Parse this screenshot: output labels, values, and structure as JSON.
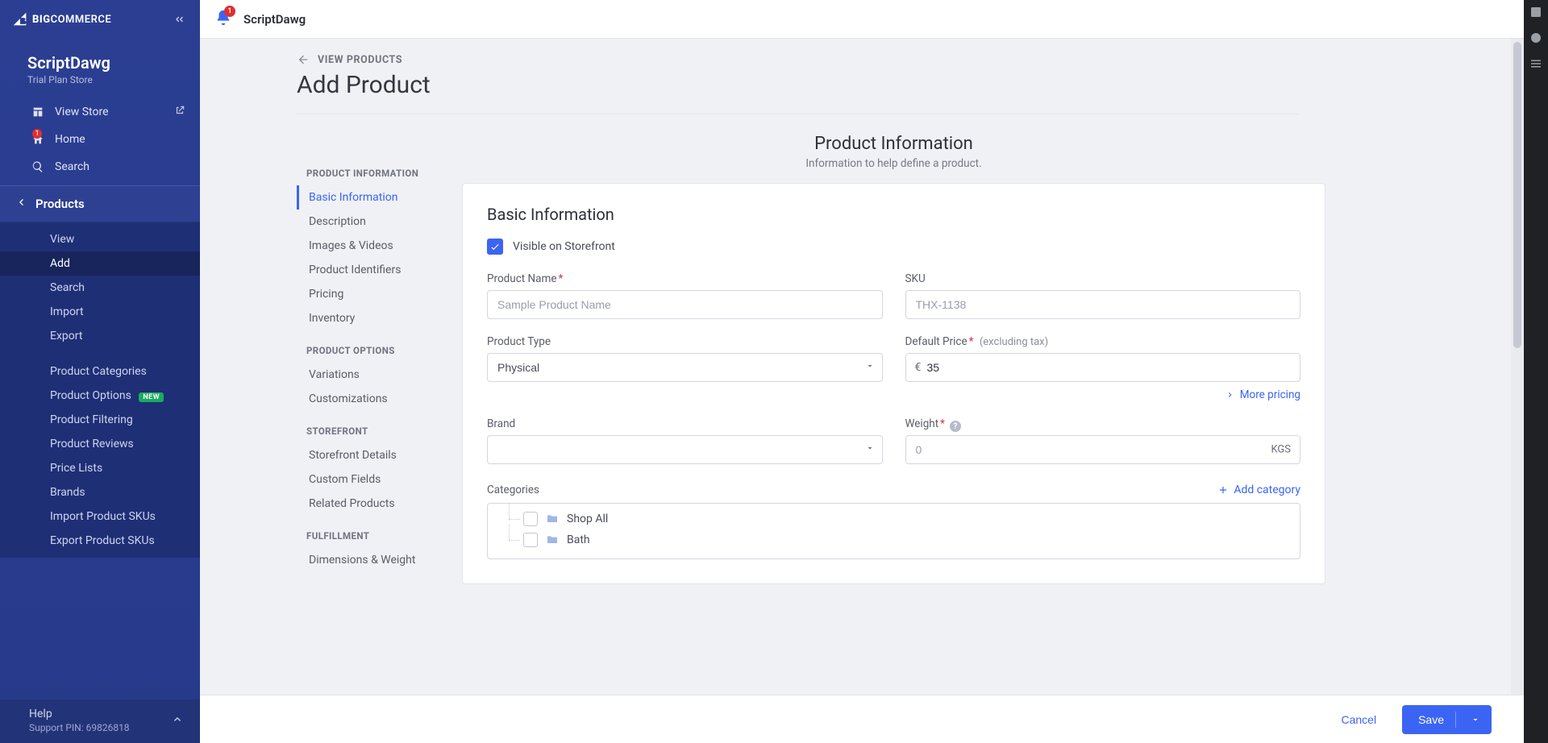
{
  "brand_text_big": "BIG",
  "brand_text_rest": "COMMERCE",
  "store": {
    "name": "ScriptDawg",
    "plan": "Trial Plan Store"
  },
  "topnav": {
    "view_store": "View Store",
    "home": "Home",
    "home_badge": "1",
    "search": "Search"
  },
  "section": {
    "products": "Products"
  },
  "subnav": {
    "view": "View",
    "add": "Add",
    "search": "Search",
    "import": "Import",
    "export": "Export",
    "categories": "Product Categories",
    "options": "Product Options",
    "options_badge": "NEW",
    "filtering": "Product Filtering",
    "reviews": "Product Reviews",
    "pricelists": "Price Lists",
    "brands": "Brands",
    "import_skus": "Import Product SKUs",
    "export_skus": "Export Product SKUs"
  },
  "help": {
    "label": "Help",
    "pin": "Support PIN: 69826818"
  },
  "topbar": {
    "bell_count": "1",
    "crumb": "ScriptDawg"
  },
  "page": {
    "back": "VIEW PRODUCTS",
    "title": "Add Product"
  },
  "anchors": {
    "g1": "PRODUCT INFORMATION",
    "basic": "Basic Information",
    "desc": "Description",
    "images": "Images & Videos",
    "ids": "Product Identifiers",
    "pricing": "Pricing",
    "inventory": "Inventory",
    "g2": "PRODUCT OPTIONS",
    "variations": "Variations",
    "custom": "Customizations",
    "g3": "STOREFRONT",
    "sfdetails": "Storefront Details",
    "cfields": "Custom Fields",
    "related": "Related Products",
    "g4": "FULFILLMENT",
    "dims": "Dimensions & Weight"
  },
  "sectionHeader": {
    "title": "Product Information",
    "sub": "Information to help define a product."
  },
  "card": {
    "title": "Basic Information",
    "visible_label": "Visible on Storefront",
    "name_label": "Product Name",
    "name_placeholder": "Sample Product Name",
    "sku_label": "SKU",
    "sku_placeholder": "THX-1138",
    "type_label": "Product Type",
    "type_value": "Physical",
    "price_label": "Default Price",
    "price_hint": "(excluding tax)",
    "price_currency": "€",
    "price_value": "35",
    "more_pricing": "More pricing",
    "brand_label": "Brand",
    "weight_label": "Weight",
    "weight_placeholder": "0",
    "weight_unit": "KGS",
    "categories_label": "Categories",
    "add_category": "Add category",
    "cat1": "Shop All",
    "cat2": "Bath"
  },
  "footer": {
    "cancel": "Cancel",
    "save": "Save"
  }
}
